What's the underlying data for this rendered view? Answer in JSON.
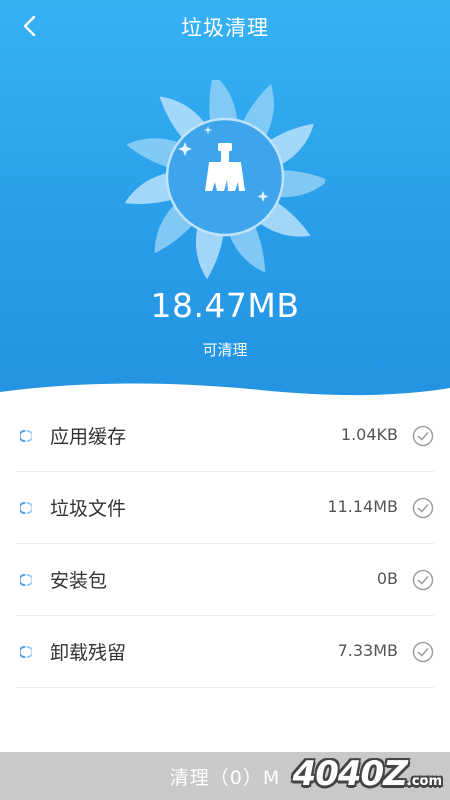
{
  "header": {
    "title": "垃圾清理",
    "size": "18.47MB",
    "caption": "可清理",
    "colors": {
      "top": "#36b2f5",
      "bottom": "#2393e2"
    }
  },
  "icons": {
    "back": "chevron-left-icon",
    "cleaner": "broom-icon",
    "row_dot": "loading-dot-icon",
    "check": "check-circle-icon"
  },
  "items": [
    {
      "label": "应用缓存",
      "value": "1.04KB"
    },
    {
      "label": "垃圾文件",
      "value": "11.14MB"
    },
    {
      "label": "安装包",
      "value": "0B"
    },
    {
      "label": "卸载残留",
      "value": "7.33MB"
    }
  ],
  "bottom": {
    "button_label": "清理（0）M"
  },
  "watermark": {
    "text": "4040Z",
    "suffix": ".com"
  }
}
